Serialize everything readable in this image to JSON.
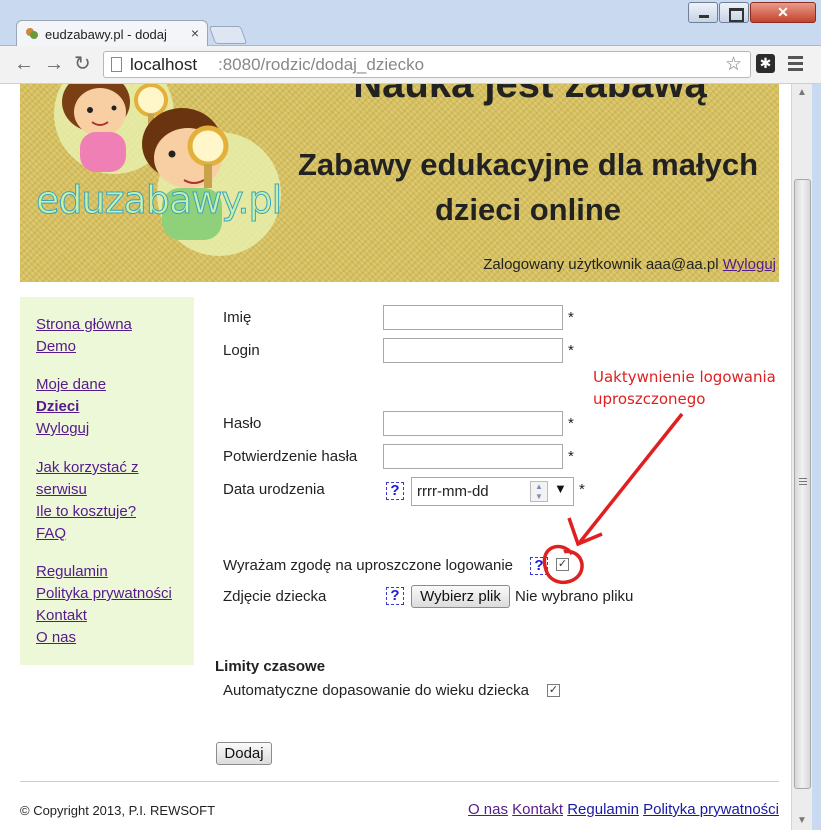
{
  "browser": {
    "tab_title": "eudzabawy.pl - dodaj",
    "tab_close": "×",
    "url_host": "localhost",
    "url_rest": ":8080/rodzic/dodaj_dziecko",
    "close_glyph": "✕"
  },
  "banner": {
    "title": "Nauka jest zabawą",
    "subtitle": "Zabawy edukacyjne dla małych dzieci online",
    "logo": "eduzabawy.pl",
    "logged_in_text": "Zalogowany użytkownik aaa@aa.pl",
    "logout_link": "Wyloguj"
  },
  "sidebar": {
    "items": [
      {
        "label": "Strona główna"
      },
      {
        "label": "Demo"
      },
      {
        "label": "Moje dane"
      },
      {
        "label": "Dzieci"
      },
      {
        "label": "Wyloguj"
      },
      {
        "label": "Jak korzystać z"
      },
      {
        "label": "serwisu"
      },
      {
        "label": "Ile to kosztuje?"
      },
      {
        "label": "FAQ"
      },
      {
        "label": "Regulamin"
      },
      {
        "label": "Polityka prywatności"
      },
      {
        "label": "Kontakt"
      },
      {
        "label": "O nas"
      }
    ]
  },
  "form": {
    "name_label": "Imię",
    "login_label": "Login",
    "password_label": "Hasło",
    "password_confirm_label": "Potwierdzenie hasła",
    "birthdate_label": "Data urodzenia",
    "birthdate_placeholder": "rrrr-mm-dd",
    "consent_label": "Wyrażam zgodę na uproszczone logowanie",
    "photo_label": "Zdjęcie dziecka",
    "file_button": "Wybierz plik",
    "file_status": "Nie wybrano pliku",
    "required_mark": "*",
    "help_mark": "?",
    "consent_checked": true,
    "auto_age_checked": true,
    "check_glyph": "✓",
    "limits_title": "Limity czasowe",
    "auto_age_label": "Automatyczne dopasowanie do wieku dziecka",
    "submit_label": "Dodaj"
  },
  "annotation": {
    "line1": "Uaktywnienie logowania",
    "line2": "uproszczonego",
    "color": "#e02020"
  },
  "footer": {
    "copyright": "© Copyright 2013, P.I. REWSOFT",
    "links": [
      {
        "label": "O nas"
      },
      {
        "label": "Kontakt"
      },
      {
        "label": "Regulamin"
      },
      {
        "label": "Polityka prywatności"
      }
    ]
  },
  "colors": {
    "banner_bg": "#d8c262",
    "sidebar_bg": "#ecf8d8",
    "link": "#551a8b",
    "help_blue": "#1a1ad8"
  }
}
